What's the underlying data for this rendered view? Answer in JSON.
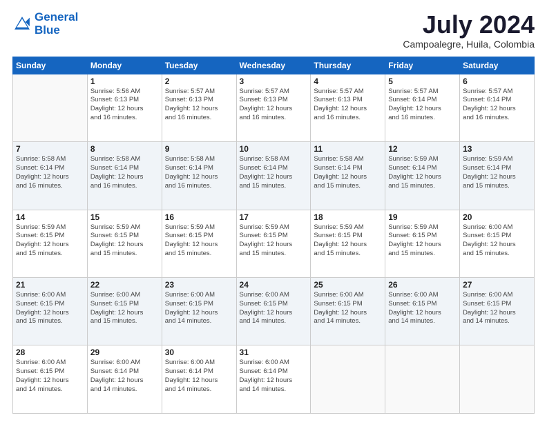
{
  "header": {
    "logo_line1": "General",
    "logo_line2": "Blue",
    "month_year": "July 2024",
    "location": "Campoalegre, Huila, Colombia"
  },
  "weekdays": [
    "Sunday",
    "Monday",
    "Tuesday",
    "Wednesday",
    "Thursday",
    "Friday",
    "Saturday"
  ],
  "weeks": [
    [
      {
        "day": "",
        "info": ""
      },
      {
        "day": "1",
        "info": "Sunrise: 5:56 AM\nSunset: 6:13 PM\nDaylight: 12 hours\nand 16 minutes."
      },
      {
        "day": "2",
        "info": "Sunrise: 5:57 AM\nSunset: 6:13 PM\nDaylight: 12 hours\nand 16 minutes."
      },
      {
        "day": "3",
        "info": "Sunrise: 5:57 AM\nSunset: 6:13 PM\nDaylight: 12 hours\nand 16 minutes."
      },
      {
        "day": "4",
        "info": "Sunrise: 5:57 AM\nSunset: 6:13 PM\nDaylight: 12 hours\nand 16 minutes."
      },
      {
        "day": "5",
        "info": "Sunrise: 5:57 AM\nSunset: 6:14 PM\nDaylight: 12 hours\nand 16 minutes."
      },
      {
        "day": "6",
        "info": "Sunrise: 5:57 AM\nSunset: 6:14 PM\nDaylight: 12 hours\nand 16 minutes."
      }
    ],
    [
      {
        "day": "7",
        "info": "Sunrise: 5:58 AM\nSunset: 6:14 PM\nDaylight: 12 hours\nand 16 minutes."
      },
      {
        "day": "8",
        "info": "Sunrise: 5:58 AM\nSunset: 6:14 PM\nDaylight: 12 hours\nand 16 minutes."
      },
      {
        "day": "9",
        "info": "Sunrise: 5:58 AM\nSunset: 6:14 PM\nDaylight: 12 hours\nand 16 minutes."
      },
      {
        "day": "10",
        "info": "Sunrise: 5:58 AM\nSunset: 6:14 PM\nDaylight: 12 hours\nand 15 minutes."
      },
      {
        "day": "11",
        "info": "Sunrise: 5:58 AM\nSunset: 6:14 PM\nDaylight: 12 hours\nand 15 minutes."
      },
      {
        "day": "12",
        "info": "Sunrise: 5:59 AM\nSunset: 6:14 PM\nDaylight: 12 hours\nand 15 minutes."
      },
      {
        "day": "13",
        "info": "Sunrise: 5:59 AM\nSunset: 6:14 PM\nDaylight: 12 hours\nand 15 minutes."
      }
    ],
    [
      {
        "day": "14",
        "info": "Sunrise: 5:59 AM\nSunset: 6:15 PM\nDaylight: 12 hours\nand 15 minutes."
      },
      {
        "day": "15",
        "info": "Sunrise: 5:59 AM\nSunset: 6:15 PM\nDaylight: 12 hours\nand 15 minutes."
      },
      {
        "day": "16",
        "info": "Sunrise: 5:59 AM\nSunset: 6:15 PM\nDaylight: 12 hours\nand 15 minutes."
      },
      {
        "day": "17",
        "info": "Sunrise: 5:59 AM\nSunset: 6:15 PM\nDaylight: 12 hours\nand 15 minutes."
      },
      {
        "day": "18",
        "info": "Sunrise: 5:59 AM\nSunset: 6:15 PM\nDaylight: 12 hours\nand 15 minutes."
      },
      {
        "day": "19",
        "info": "Sunrise: 5:59 AM\nSunset: 6:15 PM\nDaylight: 12 hours\nand 15 minutes."
      },
      {
        "day": "20",
        "info": "Sunrise: 6:00 AM\nSunset: 6:15 PM\nDaylight: 12 hours\nand 15 minutes."
      }
    ],
    [
      {
        "day": "21",
        "info": "Sunrise: 6:00 AM\nSunset: 6:15 PM\nDaylight: 12 hours\nand 15 minutes."
      },
      {
        "day": "22",
        "info": "Sunrise: 6:00 AM\nSunset: 6:15 PM\nDaylight: 12 hours\nand 15 minutes."
      },
      {
        "day": "23",
        "info": "Sunrise: 6:00 AM\nSunset: 6:15 PM\nDaylight: 12 hours\nand 14 minutes."
      },
      {
        "day": "24",
        "info": "Sunrise: 6:00 AM\nSunset: 6:15 PM\nDaylight: 12 hours\nand 14 minutes."
      },
      {
        "day": "25",
        "info": "Sunrise: 6:00 AM\nSunset: 6:15 PM\nDaylight: 12 hours\nand 14 minutes."
      },
      {
        "day": "26",
        "info": "Sunrise: 6:00 AM\nSunset: 6:15 PM\nDaylight: 12 hours\nand 14 minutes."
      },
      {
        "day": "27",
        "info": "Sunrise: 6:00 AM\nSunset: 6:15 PM\nDaylight: 12 hours\nand 14 minutes."
      }
    ],
    [
      {
        "day": "28",
        "info": "Sunrise: 6:00 AM\nSunset: 6:15 PM\nDaylight: 12 hours\nand 14 minutes."
      },
      {
        "day": "29",
        "info": "Sunrise: 6:00 AM\nSunset: 6:14 PM\nDaylight: 12 hours\nand 14 minutes."
      },
      {
        "day": "30",
        "info": "Sunrise: 6:00 AM\nSunset: 6:14 PM\nDaylight: 12 hours\nand 14 minutes."
      },
      {
        "day": "31",
        "info": "Sunrise: 6:00 AM\nSunset: 6:14 PM\nDaylight: 12 hours\nand 14 minutes."
      },
      {
        "day": "",
        "info": ""
      },
      {
        "day": "",
        "info": ""
      },
      {
        "day": "",
        "info": ""
      }
    ]
  ]
}
